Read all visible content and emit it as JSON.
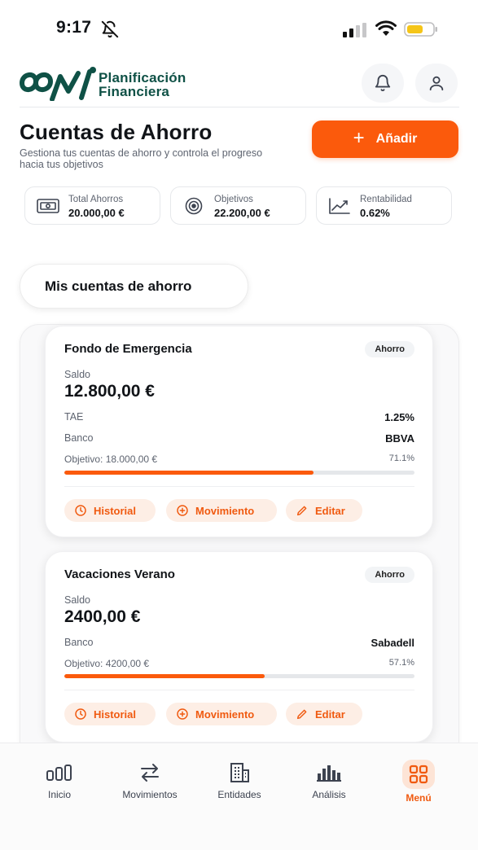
{
  "status_bar": {
    "time": "9:17"
  },
  "header": {
    "brand_line1": "Planificación",
    "brand_line2": "Financiera"
  },
  "page": {
    "title": "Cuentas de Ahorro",
    "subtitle": "Gestiona tus cuentas de ahorro y controla el progreso hacia tus objetivos",
    "add_label": "Añadir"
  },
  "stats": [
    {
      "label": "Total Ahorros",
      "value": "20.000,00 €",
      "icon": "banknote-icon"
    },
    {
      "label": "Objetivos",
      "value": "22.200,00 €",
      "icon": "target-icon"
    },
    {
      "label": "Rentabilidad",
      "value": "0.62%",
      "icon": "trend-up-icon"
    }
  ],
  "section": {
    "title": "Mis cuentas de ahorro"
  },
  "accounts": [
    {
      "name": "Fondo de Emergencia",
      "tag": "Ahorro",
      "saldo_label": "Saldo",
      "saldo": "12.800,00 €",
      "rows": [
        {
          "label": "TAE",
          "value": "1.25%"
        },
        {
          "label": "Banco",
          "value": "BBVA"
        }
      ],
      "goal_label": "Objetivo: 18.000,00 €",
      "goal_pct": "71.1%",
      "progress": 0.711
    },
    {
      "name": "Vacaciones Verano",
      "tag": "Ahorro",
      "saldo_label": "Saldo",
      "saldo": "2400,00 €",
      "rows": [
        {
          "label": "Banco",
          "value": "Sabadell"
        }
      ],
      "goal_label": "Objetivo: 4200,00 €",
      "goal_pct": "57.1%",
      "progress": 0.571
    }
  ],
  "actions": {
    "history": "Historial",
    "movement": "Movimiento",
    "edit": "Editar"
  },
  "nav": {
    "inicio": "Inicio",
    "movimientos": "Movimientos",
    "entidades": "Entidades",
    "analisis": "Análisis",
    "menu": "Menú"
  },
  "colors": {
    "accent": "#fb5a0c",
    "brand": "#0f5146",
    "chip_bg": "#fdeee5"
  }
}
